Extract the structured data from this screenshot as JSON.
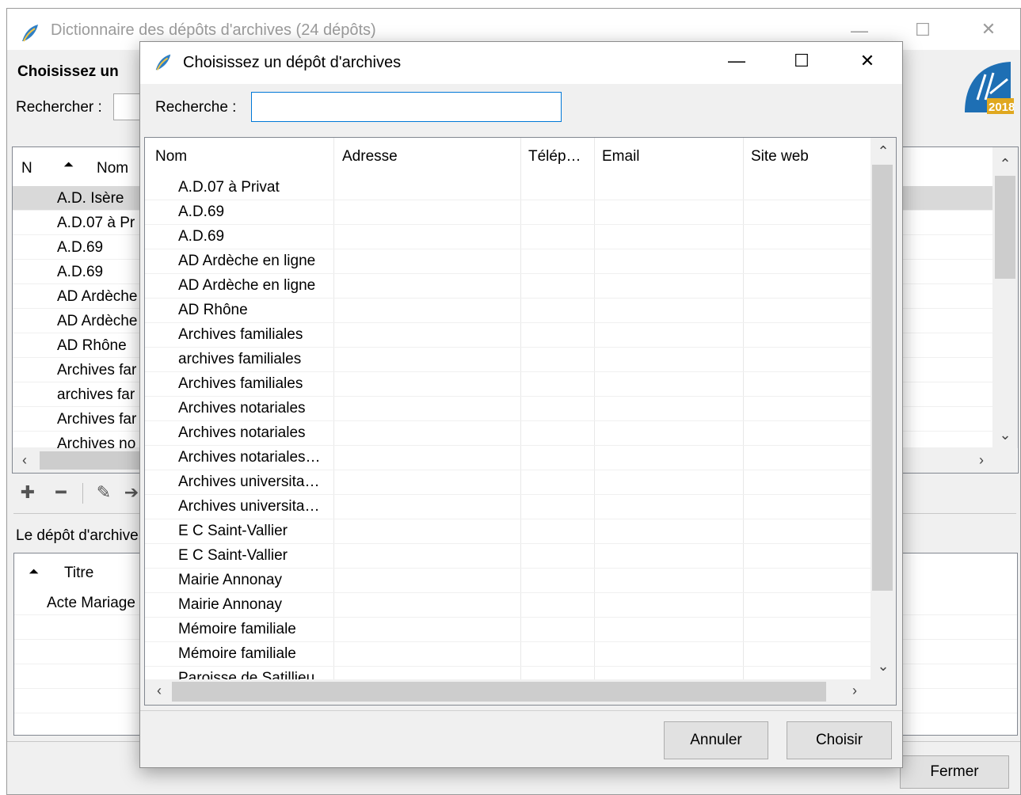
{
  "parent_window": {
    "title": "Dictionnaire des dépôts d'archives (24 dépôts)",
    "heading": "Choisissez un",
    "search_label": "Rechercher :",
    "search_value": "",
    "table": {
      "columns": [
        "N",
        "Nom"
      ],
      "rows": [
        "A.D. Isère",
        "A.D.07 à Pr",
        "A.D.69",
        "A.D.69",
        "AD Ardèche",
        "AD Ardèche",
        "AD Rhône",
        "Archives far",
        "archives far",
        "Archives far",
        "Archives no"
      ]
    },
    "depot_label": "Le dépôt d'archive",
    "documents": {
      "columns": [
        "Titre"
      ],
      "rows": [
        "Acte Mariage"
      ]
    },
    "close_button": "Fermer",
    "logo_text": "2018"
  },
  "dialog": {
    "title": "Choisissez un dépôt d'archives",
    "search_label": "Recherche :",
    "search_value": "",
    "table": {
      "columns": [
        "Nom",
        "Adresse",
        "Télép…",
        "Email",
        "Site web"
      ],
      "rows": [
        "A.D.07 à Privat",
        "A.D.69",
        "A.D.69",
        "AD Ardèche en ligne",
        "AD Ardèche en ligne",
        "AD Rhône",
        "Archives familiales",
        "archives familiales",
        "Archives familiales",
        "Archives notariales",
        "Archives notariales",
        "Archives notariales…",
        "Archives universita…",
        "Archives universita…",
        "E C Saint-Vallier",
        "E C Saint-Vallier",
        "Mairie Annonay",
        "Mairie Annonay",
        "Mémoire familiale",
        "Mémoire familiale",
        "Paroisse de Satillieu"
      ]
    },
    "cancel_button": "Annuler",
    "choose_button": "Choisir"
  },
  "icons": {
    "app": "feather-icon",
    "minimize": "minimize-icon",
    "maximize": "maximize-icon",
    "close": "close-icon",
    "sort": "sort-ascending-icon",
    "add": "plus-icon",
    "remove": "minus-icon",
    "edit": "pencil-icon"
  },
  "colors": {
    "focus_border": "#0078d7",
    "selected_row": "#d9d9d9",
    "logo_blue": "#1e6fb4",
    "logo_gold": "#e0a81f"
  }
}
